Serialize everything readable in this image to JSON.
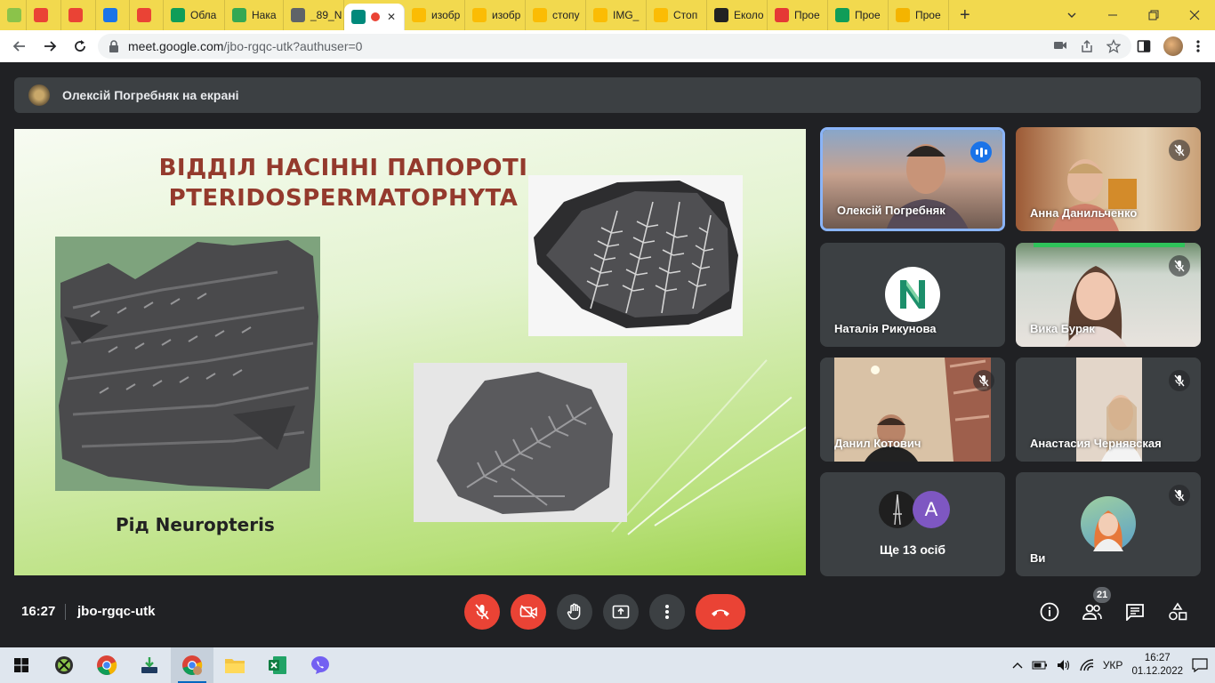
{
  "browser": {
    "tabs": [
      {
        "label": "",
        "favicon_color": "#8bc34a",
        "favicon": "calendar-icon"
      },
      {
        "label": "",
        "favicon_color": "#ea4335",
        "favicon": "gmail-icon"
      },
      {
        "label": "",
        "favicon_color": "#ea4335",
        "favicon": "gmail-icon"
      },
      {
        "label": "",
        "favicon_color": "#1a73e8",
        "favicon": "classroom-icon"
      },
      {
        "label": "",
        "favicon_color": "#ea4335",
        "favicon": "gmail-icon"
      },
      {
        "label": "Обла",
        "favicon_color": "#0f9d58",
        "favicon": "sheets-icon"
      },
      {
        "label": "Нака",
        "favicon_color": "#34a853",
        "favicon": "shield-icon"
      },
      {
        "label": "_89_N",
        "favicon_color": "#5f6368",
        "favicon": "globe-icon"
      },
      {
        "label": "",
        "favicon_color": "#00897b",
        "favicon": "meet-icon",
        "active": true
      },
      {
        "label": "изобр",
        "favicon_color": "#fbbc04",
        "favicon": "drive-icon"
      },
      {
        "label": "изобр",
        "favicon_color": "#fbbc04",
        "favicon": "drive-icon"
      },
      {
        "label": "стопу",
        "favicon_color": "#fbbc04",
        "favicon": "drive-icon"
      },
      {
        "label": "IMG_",
        "favicon_color": "#fbbc04",
        "favicon": "drive-icon"
      },
      {
        "label": "Стоп",
        "favicon_color": "#fbbc04",
        "favicon": "drive-icon"
      },
      {
        "label": "Еколо",
        "favicon_color": "#222222",
        "favicon": "mask-icon"
      },
      {
        "label": "Прое",
        "favicon_color": "#e53935",
        "favicon": "app-icon"
      },
      {
        "label": "Прое",
        "favicon_color": "#0f9d58",
        "favicon": "sheets-icon"
      },
      {
        "label": "Прое",
        "favicon_color": "#f4b400",
        "favicon": "slides-icon"
      }
    ],
    "url_host": "meet.google.com",
    "url_path": "/jbo-rgqc-utk?authuser=0"
  },
  "presenter_banner": {
    "text": "Олексій Погребняк на екрані"
  },
  "slide": {
    "title_line1": "ВІДДІЛ НАСІННІ ПАПОРОТІ",
    "title_line2": "PTERIDOSPERMATOPHYTA",
    "caption": "Рід Neuropteris"
  },
  "participants": [
    {
      "name": "Олексій Погребняк",
      "state": "speaking"
    },
    {
      "name": "Анна Данильченко",
      "state": "muted"
    },
    {
      "name": "Наталія Рикунова",
      "state": "normal",
      "initial": "N"
    },
    {
      "name": "Вика Буряк",
      "state": "muted"
    },
    {
      "name": "Данил Котович",
      "state": "muted"
    },
    {
      "name": "Анастасия Чернявская",
      "state": "muted"
    },
    {
      "name": "Ще 13 осіб",
      "state": "others",
      "initial": "A"
    },
    {
      "name": "Ви",
      "state": "muted"
    }
  ],
  "meeting": {
    "time": "16:27",
    "code": "jbo-rgqc-utk",
    "participant_count": "21"
  },
  "taskbar": {
    "lang": "УКР",
    "time": "16:27",
    "date": "01.12.2022"
  },
  "colors": {
    "meet_red": "#ea4335",
    "meet_dark": "#202124",
    "tile_bg": "#3c4043",
    "speaking_blue": "#8ab4f8",
    "tab_strip": "#f2d94e",
    "slide_title": "#943a2d"
  }
}
